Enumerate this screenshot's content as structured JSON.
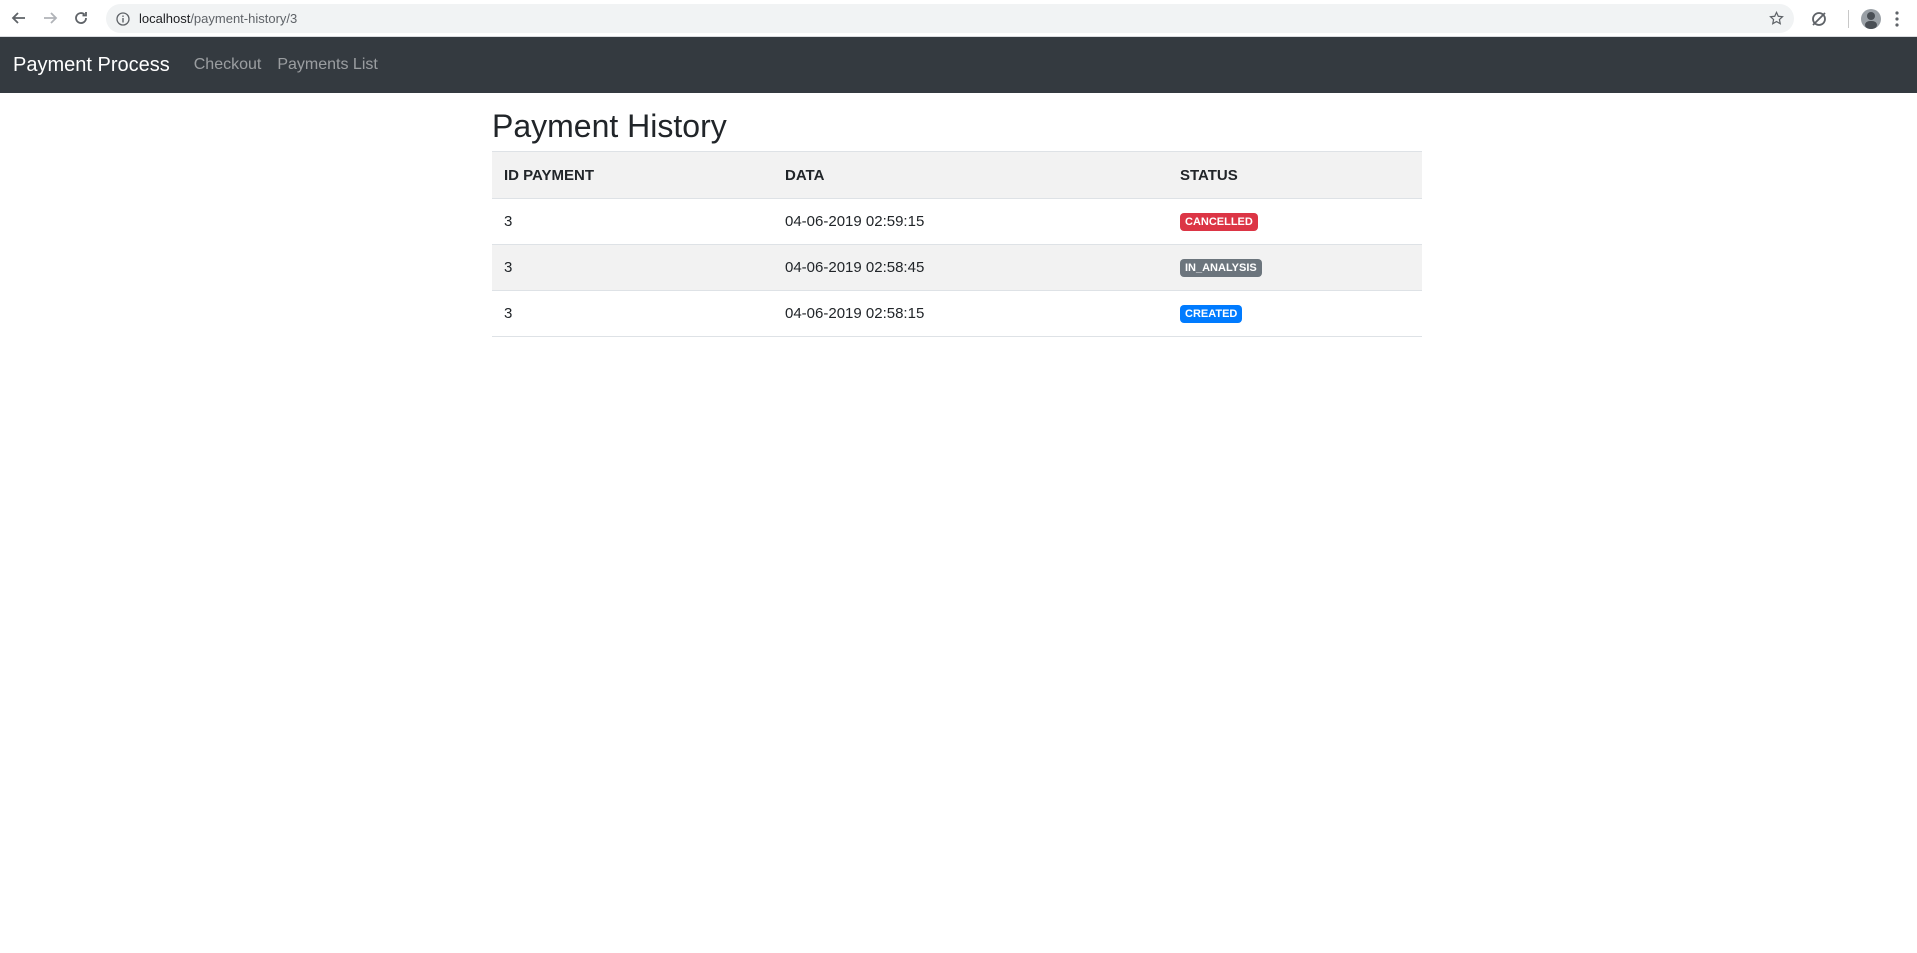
{
  "browser": {
    "url_host": "localhost",
    "url_path": "/payment-history/3"
  },
  "navbar": {
    "brand": "Payment Process",
    "links": [
      "Checkout",
      "Payments List"
    ]
  },
  "page": {
    "title": "Payment History"
  },
  "table": {
    "headers": [
      "ID PAYMENT",
      "DATA",
      "STATUS"
    ],
    "rows": [
      {
        "id": "3",
        "date": "04-06-2019 02:59:15",
        "status": "CANCELLED",
        "status_color": "#dc3545"
      },
      {
        "id": "3",
        "date": "04-06-2019 02:58:45",
        "status": "IN_ANALYSIS",
        "status_color": "#6c757d"
      },
      {
        "id": "3",
        "date": "04-06-2019 02:58:15",
        "status": "CREATED",
        "status_color": "#007bff"
      }
    ]
  }
}
